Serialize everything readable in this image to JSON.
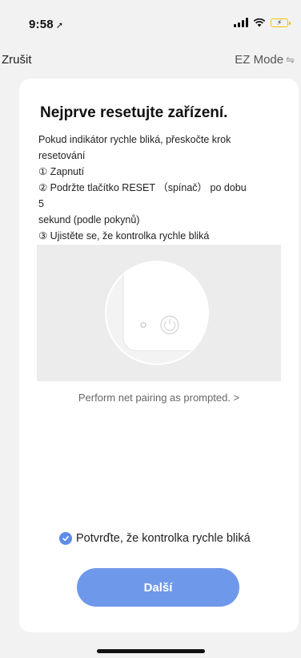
{
  "status": {
    "time": "9:58",
    "battery_color": "#f2c500"
  },
  "nav": {
    "cancel": "Zrušit",
    "mode": "EZ Mode",
    "mode_icon": "swap-arrows-icon"
  },
  "card": {
    "title": "Nejprve resetujte zařízení.",
    "instructions": [
      "Pokud indikátor rychle bliká, přeskočte krok",
      "resetování",
      "① Zapnutí",
      "② Podržte tlačítko RESET （spínač） po dobu 5",
      "sekund (podle pokynů)",
      "③ Ujistěte se, že kontrolka rychle bliká"
    ],
    "pair_link": "Perform net pairing as prompted. >",
    "confirm": "Potvrďte, že kontrolka rychle bliká",
    "next_button": "Další"
  },
  "colors": {
    "accent": "#6e98ea",
    "check": "#5b8de8"
  }
}
